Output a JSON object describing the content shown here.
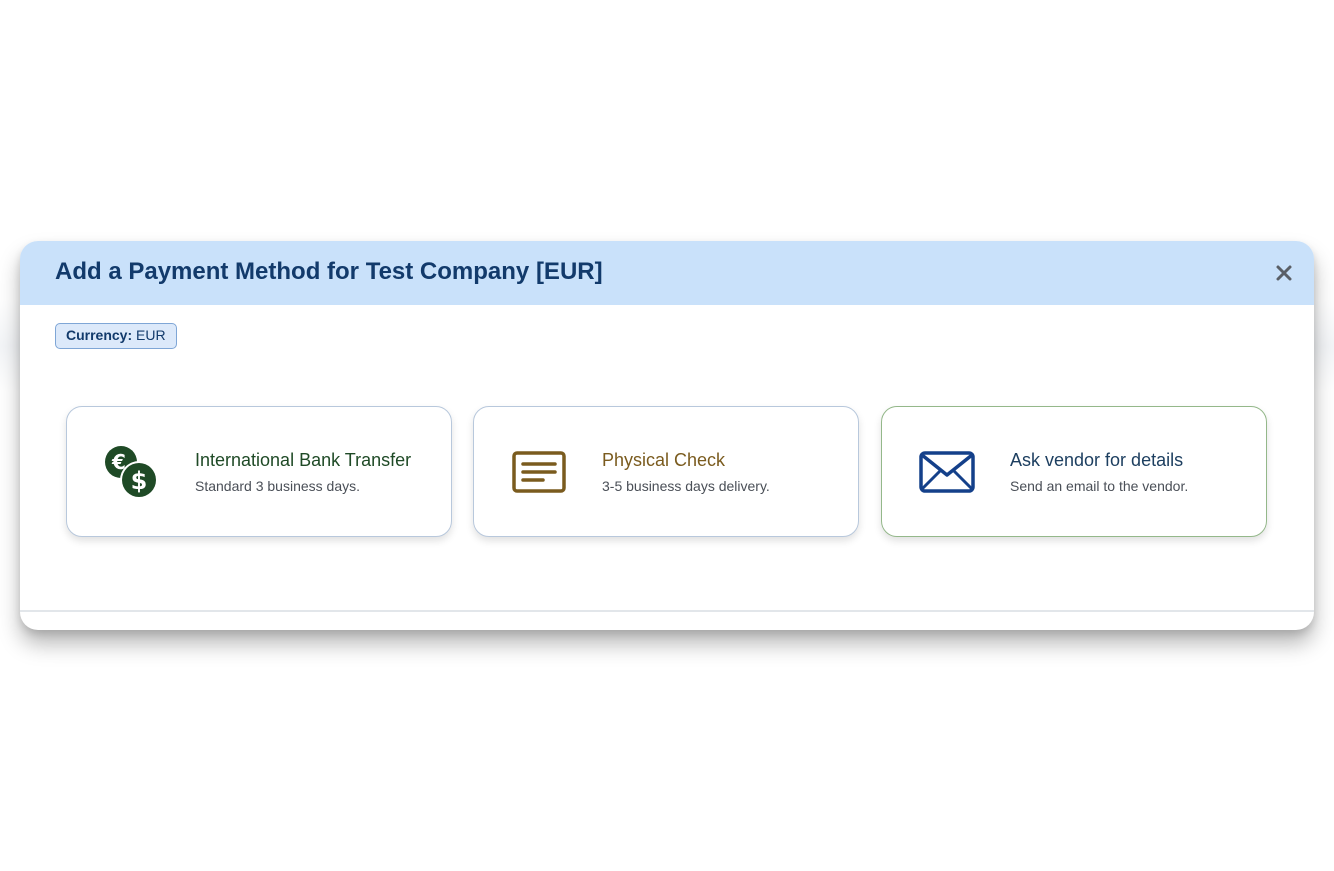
{
  "modal": {
    "title": "Add a Payment Method for Test Company [EUR]",
    "close_label": "×"
  },
  "currency": {
    "label": "Currency:",
    "value": "EUR"
  },
  "options": [
    {
      "title": "International Bank Transfer",
      "description": "Standard 3 business days.",
      "icon": "currency-coins-icon",
      "color": "#1f4a26"
    },
    {
      "title": "Physical Check",
      "description": "3-5 business days delivery.",
      "icon": "check-icon",
      "color": "#7a5b1e"
    },
    {
      "title": "Ask vendor for details",
      "description": "Send an email to the vendor.",
      "icon": "envelope-icon",
      "color": "#1d3f60"
    }
  ],
  "colors": {
    "header_bg": "#c9e1fa",
    "title": "#123a6b",
    "selected_border": "#94b88a"
  }
}
